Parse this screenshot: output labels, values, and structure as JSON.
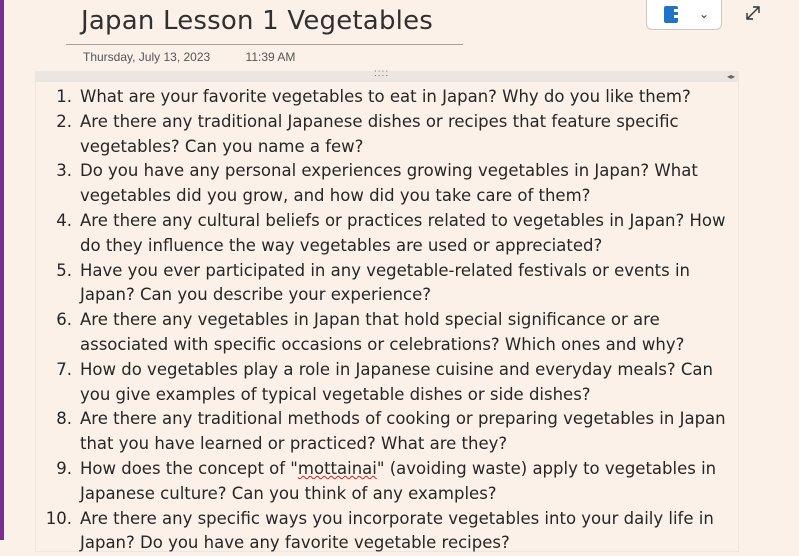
{
  "page": {
    "title": "Japan Lesson 1 Vegetables",
    "date": "Thursday, July 13, 2023",
    "time": "11:39 AM"
  },
  "toolbar": {
    "notebook_icon": "notebook-icon",
    "chevron": "⌄",
    "expand_icon": "expand-icon"
  },
  "container": {
    "handle": "::::",
    "arrows": "◂▸"
  },
  "questions": [
    {
      "num": "1.",
      "text": "What are your favorite vegetables to eat in Japan? Why do you like them?"
    },
    {
      "num": "2.",
      "text": "Are there any traditional Japanese dishes or recipes that feature specific vegetables? Can you name a few?"
    },
    {
      "num": "3.",
      "text": "Do you have any personal experiences growing vegetables in Japan? What vegetables did you grow, and how did you take care of them?"
    },
    {
      "num": "4.",
      "text": "Are there any cultural beliefs or practices related to vegetables in Japan? How do they influence the way vegetables are used or appreciated?"
    },
    {
      "num": "5.",
      "text": "Have you ever participated in any vegetable-related festivals or events in Japan? Can you describe your experience?"
    },
    {
      "num": "6.",
      "text": "Are there any vegetables in Japan that hold special significance or are associated with specific occasions or celebrations? Which ones and why?"
    },
    {
      "num": "7.",
      "text": "How do vegetables play a role in Japanese cuisine and everyday meals? Can you give examples of typical vegetable dishes or side dishes?"
    },
    {
      "num": "8.",
      "text": "Are there any traditional methods of cooking or preparing vegetables in Japan that you have learned or practiced? What are they?"
    },
    {
      "num": "9.",
      "text_before": "How does the concept of \"",
      "text_flagged": "mottainai",
      "text_after": "\" (avoiding waste) apply to vegetables in Japanese culture? Can you think of any examples?"
    },
    {
      "num": "10.",
      "text": "Are there any specific ways you incorporate vegetables into your daily life in Japan? Do you have any favorite vegetable recipes?"
    }
  ],
  "colors": {
    "page_background": "#fbf1e9",
    "accent_strip": "#7a2e8f",
    "notebook_blue": "#1f74c8",
    "spellcheck_red": "#d02020"
  }
}
